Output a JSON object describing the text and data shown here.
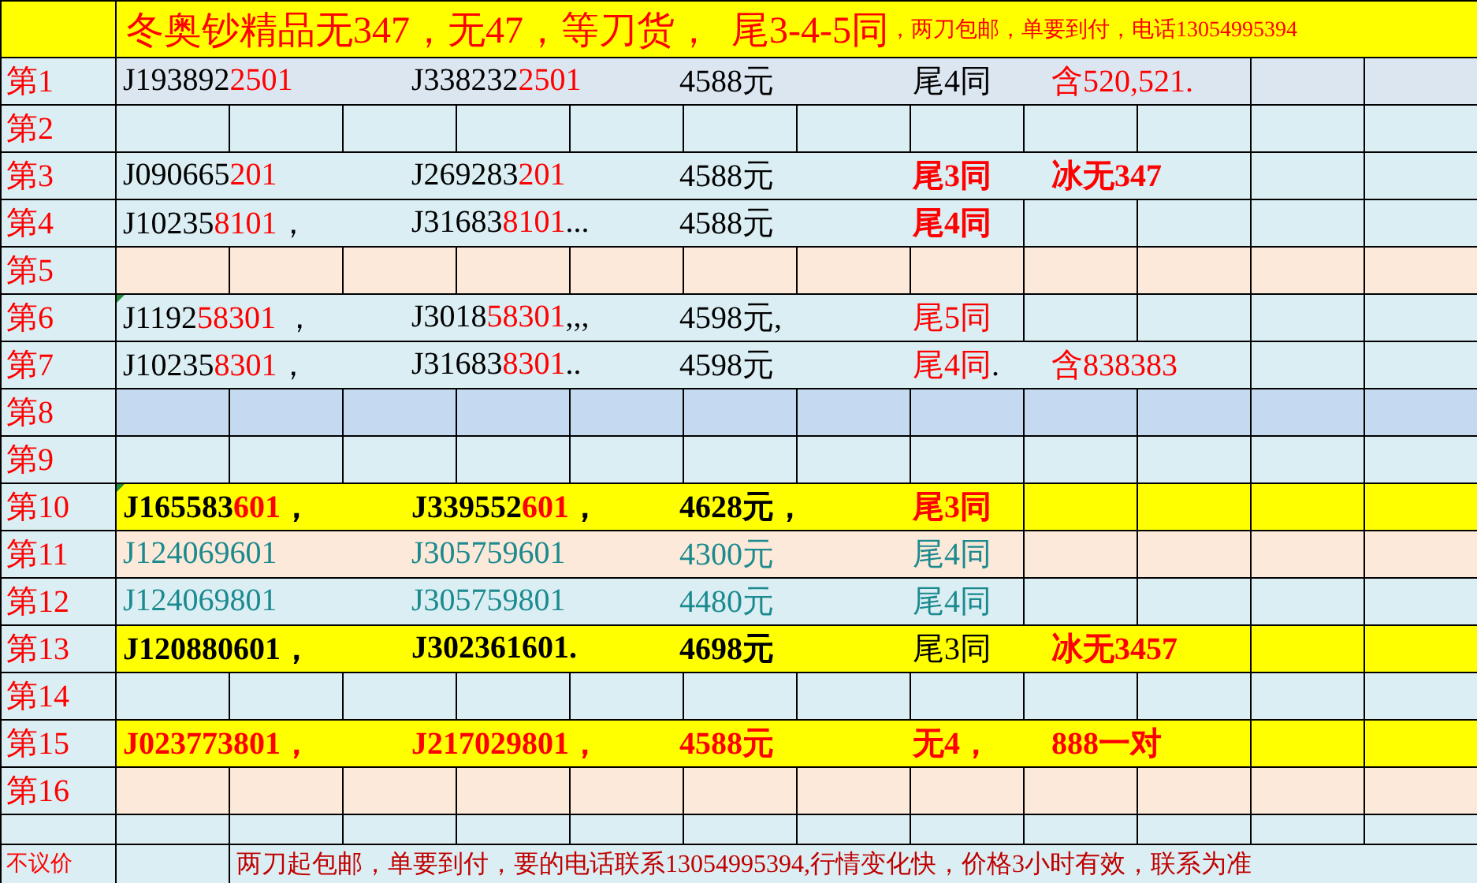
{
  "header": {
    "title": "冬奥钞精品无347，无47，等刀货，  尾3-4-5同",
    "note": "，两刀包邮，单要到付，电话13054995394"
  },
  "rows": [
    {
      "label": "第1",
      "color": "#dce6f1",
      "flagged": false,
      "colspan": 10,
      "fields": [
        {
          "bold": false,
          "parts": [
            {
              "text": "J193892",
              "color": "#000000"
            },
            {
              "text": "2501",
              "color": "#ff0000"
            }
          ]
        },
        {
          "bold": false,
          "parts": [
            {
              "text": "J338232",
              "color": "#000000"
            },
            {
              "text": "2501",
              "color": "#ff0000"
            }
          ]
        },
        {
          "bold": false,
          "parts": [
            {
              "text": "4588元",
              "color": "#000000"
            }
          ]
        },
        {
          "bold": false,
          "parts": [
            {
              "text": "尾4同",
              "color": "#000000"
            }
          ]
        },
        {
          "bold": false,
          "parts": [
            {
              "text": "含520,521.",
              "color": "#ff0000"
            }
          ]
        }
      ]
    },
    {
      "label": "第2",
      "color": "#daeef3",
      "flagged": false
    },
    {
      "label": "第3",
      "color": "#daeef3",
      "flagged": false,
      "colspan": 10,
      "fields": [
        {
          "bold": false,
          "parts": [
            {
              "text": "J090665",
              "color": "#000000"
            },
            {
              "text": "201",
              "color": "#ff0000"
            }
          ]
        },
        {
          "bold": false,
          "parts": [
            {
              "text": "J269283",
              "color": "#000000"
            },
            {
              "text": "201",
              "color": "#ff0000"
            }
          ]
        },
        {
          "bold": false,
          "parts": [
            {
              "text": "4588元",
              "color": "#000000"
            }
          ]
        },
        {
          "bold": true,
          "parts": [
            {
              "text": "尾3同",
              "color": "#ff0000"
            }
          ]
        },
        {
          "bold": true,
          "parts": [
            {
              "text": "冰无347",
              "color": "#ff0000"
            }
          ]
        }
      ]
    },
    {
      "label": "第4",
      "color": "#daeef3",
      "flagged": false,
      "colspan": 8,
      "fields": [
        {
          "bold": false,
          "parts": [
            {
              "text": "J10235",
              "color": "#000000"
            },
            {
              "text": "8101",
              "color": "#ff0000"
            },
            {
              "text": "，",
              "color": "#000000"
            }
          ]
        },
        {
          "bold": false,
          "parts": [
            {
              "text": "J31683",
              "color": "#000000"
            },
            {
              "text": "8101",
              "color": "#ff0000"
            },
            {
              "text": "...",
              "color": "#000000"
            }
          ]
        },
        {
          "bold": false,
          "parts": [
            {
              "text": "4588元",
              "color": "#000000"
            }
          ]
        },
        {
          "bold": true,
          "parts": [
            {
              "text": "尾4同",
              "color": "#ff0000"
            }
          ]
        }
      ]
    },
    {
      "label": "第5",
      "color": "#fde9d9",
      "flagged": false
    },
    {
      "label": "第6",
      "color": "#daeef3",
      "flagged": true,
      "colspan": 8,
      "fields": [
        {
          "bold": false,
          "parts": [
            {
              "text": "J1192",
              "color": "#000000"
            },
            {
              "text": "58301",
              "color": "#ff0000"
            },
            {
              "text": " ，",
              "color": "#000000"
            }
          ]
        },
        {
          "bold": false,
          "parts": [
            {
              "text": "J3018",
              "color": "#000000"
            },
            {
              "text": "58301",
              "color": "#ff0000"
            },
            {
              "text": ",,,",
              "color": "#000000"
            }
          ]
        },
        {
          "bold": false,
          "parts": [
            {
              "text": "4598元,",
              "color": "#000000"
            }
          ]
        },
        {
          "bold": false,
          "parts": [
            {
              "text": "尾5同",
              "color": "#ff0000"
            }
          ]
        }
      ]
    },
    {
      "label": "第7",
      "color": "#daeef3",
      "flagged": false,
      "colspan": 10,
      "fields": [
        {
          "bold": false,
          "parts": [
            {
              "text": "J10235",
              "color": "#000000"
            },
            {
              "text": "8301",
              "color": "#ff0000"
            },
            {
              "text": "，",
              "color": "#000000"
            }
          ]
        },
        {
          "bold": false,
          "parts": [
            {
              "text": "J31683",
              "color": "#000000"
            },
            {
              "text": "8301",
              "color": "#ff0000"
            },
            {
              "text": "..",
              "color": "#000000"
            }
          ]
        },
        {
          "bold": false,
          "parts": [
            {
              "text": "4598元",
              "color": "#000000"
            }
          ]
        },
        {
          "bold": false,
          "parts": [
            {
              "text": "尾4同",
              "color": "#ff0000"
            },
            {
              "text": ".",
              "color": "#000000"
            }
          ]
        },
        {
          "bold": false,
          "parts": [
            {
              "text": "含838383",
              "color": "#ff0000"
            }
          ]
        }
      ]
    },
    {
      "label": "第8",
      "color": "#c5d9f1",
      "flagged": false
    },
    {
      "label": "第9",
      "color": "#daeef3",
      "flagged": false
    },
    {
      "label": "第10",
      "color": "#ffff00",
      "flagged": true,
      "colspan": 8,
      "fields": [
        {
          "bold": true,
          "parts": [
            {
              "text": "J165583",
              "color": "#000000"
            },
            {
              "text": "601",
              "color": "#ff0000"
            },
            {
              "text": "，",
              "color": "#000000"
            }
          ]
        },
        {
          "bold": true,
          "parts": [
            {
              "text": "J339552",
              "color": "#000000"
            },
            {
              "text": "601",
              "color": "#ff0000"
            },
            {
              "text": "，",
              "color": "#000000"
            }
          ]
        },
        {
          "bold": true,
          "parts": [
            {
              "text": "4628元，",
              "color": "#000000"
            }
          ]
        },
        {
          "bold": true,
          "parts": [
            {
              "text": "尾3同",
              "color": "#ff0000"
            }
          ]
        }
      ]
    },
    {
      "label": "第11",
      "color": "#fde9d9",
      "flagged": false,
      "colspan": 8,
      "fields": [
        {
          "bold": false,
          "parts": [
            {
              "text": "J124069601",
              "color": "#1b8a8f"
            }
          ]
        },
        {
          "bold": false,
          "parts": [
            {
              "text": "J305759601",
              "color": "#1b8a8f"
            }
          ]
        },
        {
          "bold": false,
          "parts": [
            {
              "text": "4300元",
              "color": "#1b8a8f"
            }
          ]
        },
        {
          "bold": false,
          "parts": [
            {
              "text": "尾4同",
              "color": "#1b8a8f"
            }
          ]
        }
      ]
    },
    {
      "label": "第12",
      "color": "#daeef3",
      "flagged": false,
      "colspan": 8,
      "fields": [
        {
          "bold": false,
          "parts": [
            {
              "text": "J124069801",
              "color": "#1b8a8f"
            }
          ]
        },
        {
          "bold": false,
          "parts": [
            {
              "text": "J305759801",
              "color": "#1b8a8f"
            }
          ]
        },
        {
          "bold": false,
          "parts": [
            {
              "text": "4480元",
              "color": "#1b8a8f"
            }
          ]
        },
        {
          "bold": false,
          "parts": [
            {
              "text": "尾4同",
              "color": "#1b8a8f"
            }
          ]
        }
      ]
    },
    {
      "label": "第13",
      "color": "#ffff00",
      "flagged": false,
      "colspan": 10,
      "fields": [
        {
          "bold": true,
          "parts": [
            {
              "text": "J120880601，",
              "color": "#000000"
            }
          ]
        },
        {
          "bold": true,
          "parts": [
            {
              "text": "J302361601.",
              "color": "#000000"
            }
          ]
        },
        {
          "bold": true,
          "parts": [
            {
              "text": "4698元",
              "color": "#000000"
            }
          ]
        },
        {
          "bold": false,
          "parts": [
            {
              "text": "尾3同",
              "color": "#000000"
            }
          ]
        },
        {
          "bold": true,
          "parts": [
            {
              "text": "冰无3457",
              "color": "#ff0000"
            }
          ]
        }
      ]
    },
    {
      "label": "第14",
      "color": "#daeef3",
      "flagged": false
    },
    {
      "label": "第15",
      "color": "#ffff00",
      "flagged": false,
      "colspan": 10,
      "fields": [
        {
          "bold": true,
          "parts": [
            {
              "text": "J023773801，",
              "color": "#ff0000"
            }
          ]
        },
        {
          "bold": true,
          "parts": [
            {
              "text": "J217029801，",
              "color": "#ff0000"
            }
          ]
        },
        {
          "bold": true,
          "parts": [
            {
              "text": "4588元",
              "color": "#ff0000"
            }
          ]
        },
        {
          "bold": true,
          "parts": [
            {
              "text": "无4，",
              "color": "#ff0000"
            }
          ]
        },
        {
          "bold": true,
          "parts": [
            {
              "text": "888一对",
              "color": "#ff0000"
            }
          ]
        }
      ]
    },
    {
      "label": "第16",
      "color": "#fde9d9",
      "flagged": false
    }
  ],
  "footer": {
    "label": "不议价",
    "note": "两刀起包邮，单要到付，要的电话联系13054995394,行情变化快，价格3小时有效，联系为准"
  }
}
